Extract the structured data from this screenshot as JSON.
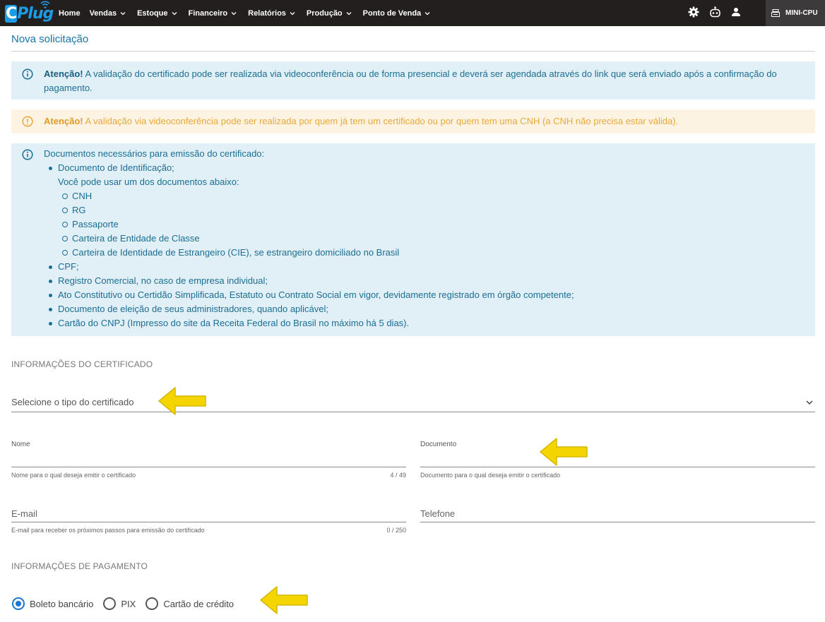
{
  "brand": {
    "name": "Plug"
  },
  "nav": [
    {
      "label": "Home",
      "has_menu": false
    },
    {
      "label": "Vendas",
      "has_menu": true
    },
    {
      "label": "Estoque",
      "has_menu": true
    },
    {
      "label": "Financeiro",
      "has_menu": true
    },
    {
      "label": "Relatórios",
      "has_menu": true
    },
    {
      "label": "Produção",
      "has_menu": true
    },
    {
      "label": "Ponto de Venda",
      "has_menu": true
    }
  ],
  "top_icons": [
    "gear-icon",
    "robot-icon",
    "user-icon"
  ],
  "device": {
    "label": "MINI-CPU",
    "icon": "register-icon"
  },
  "page": {
    "title": "Nova solicitação"
  },
  "alerts": {
    "info1": {
      "strong": "Atenção!",
      "text": " A validação do certificado pode ser realizada via videoconferência ou de forma presencial e deverá ser agendada através do link que será enviado após a confirmação do pagamento."
    },
    "warn": {
      "strong": "Atenção!",
      "text": " A validação via videoconferência pode ser realizada por quem já tem um certificado ou por quem tem uma CNH (a CNH não precisa estar válida)."
    },
    "docs": {
      "intro": "Documentos necessários para emissão do certificado:",
      "id_doc": "Documento de Identificação;",
      "id_hint": "Você pode usar um dos documentos abaixo:",
      "id_options": [
        "CNH",
        "RG",
        "Passaporte",
        "Carteira de Entidade de Classe",
        "Carteira de Identidade de Estrangeiro (CIE), se estrangeiro domiciliado no Brasil"
      ],
      "others": [
        "CPF;",
        "Registro Comercial, no caso de empresa individual;",
        "Ato Constitutivo ou Certidão Simplificada, Estatuto ou Contrato Social em vigor, devidamente registrado em órgão competente;",
        "Documento de eleição de seus administradores, quando aplicável;",
        "Cartão do CNPJ (Impresso do site da Receita Federal do Brasil no máximo há 5 dias)."
      ]
    }
  },
  "cert_section": {
    "heading": "INFORMAÇÕES DO CERTIFICADO",
    "select_placeholder": "Selecione o tipo do certificado"
  },
  "fields": {
    "nome": {
      "label": "Nome",
      "value": "",
      "hint": "Nome para o qual deseja emitir o certificado",
      "counter": "4 / 49"
    },
    "documento": {
      "label": "Documento",
      "value": "",
      "hint": "Documento para o qual deseja emitir o certificado"
    },
    "email": {
      "label": "E-mail",
      "hint": "E-mail para receber os próximos passos para emissão do certificado",
      "counter": "0 / 250"
    },
    "telefone": {
      "label": "Telefone"
    }
  },
  "payment_section": {
    "heading": "INFORMAÇÕES DE PAGAMENTO",
    "options": [
      {
        "label": "Boleto bancário",
        "checked": true
      },
      {
        "label": "PIX",
        "checked": false
      },
      {
        "label": "Cartão de crédito",
        "checked": false
      }
    ]
  },
  "colors": {
    "topbar": "#231f1f",
    "brand_blue": "#1c9be6",
    "info_bg": "#e1eff6",
    "info_text": "#1b6e93",
    "warn_bg": "#fdf3e3",
    "warn_text": "#e8a93b",
    "radio_accent": "#1976d2",
    "arrow": "#f5d500"
  }
}
